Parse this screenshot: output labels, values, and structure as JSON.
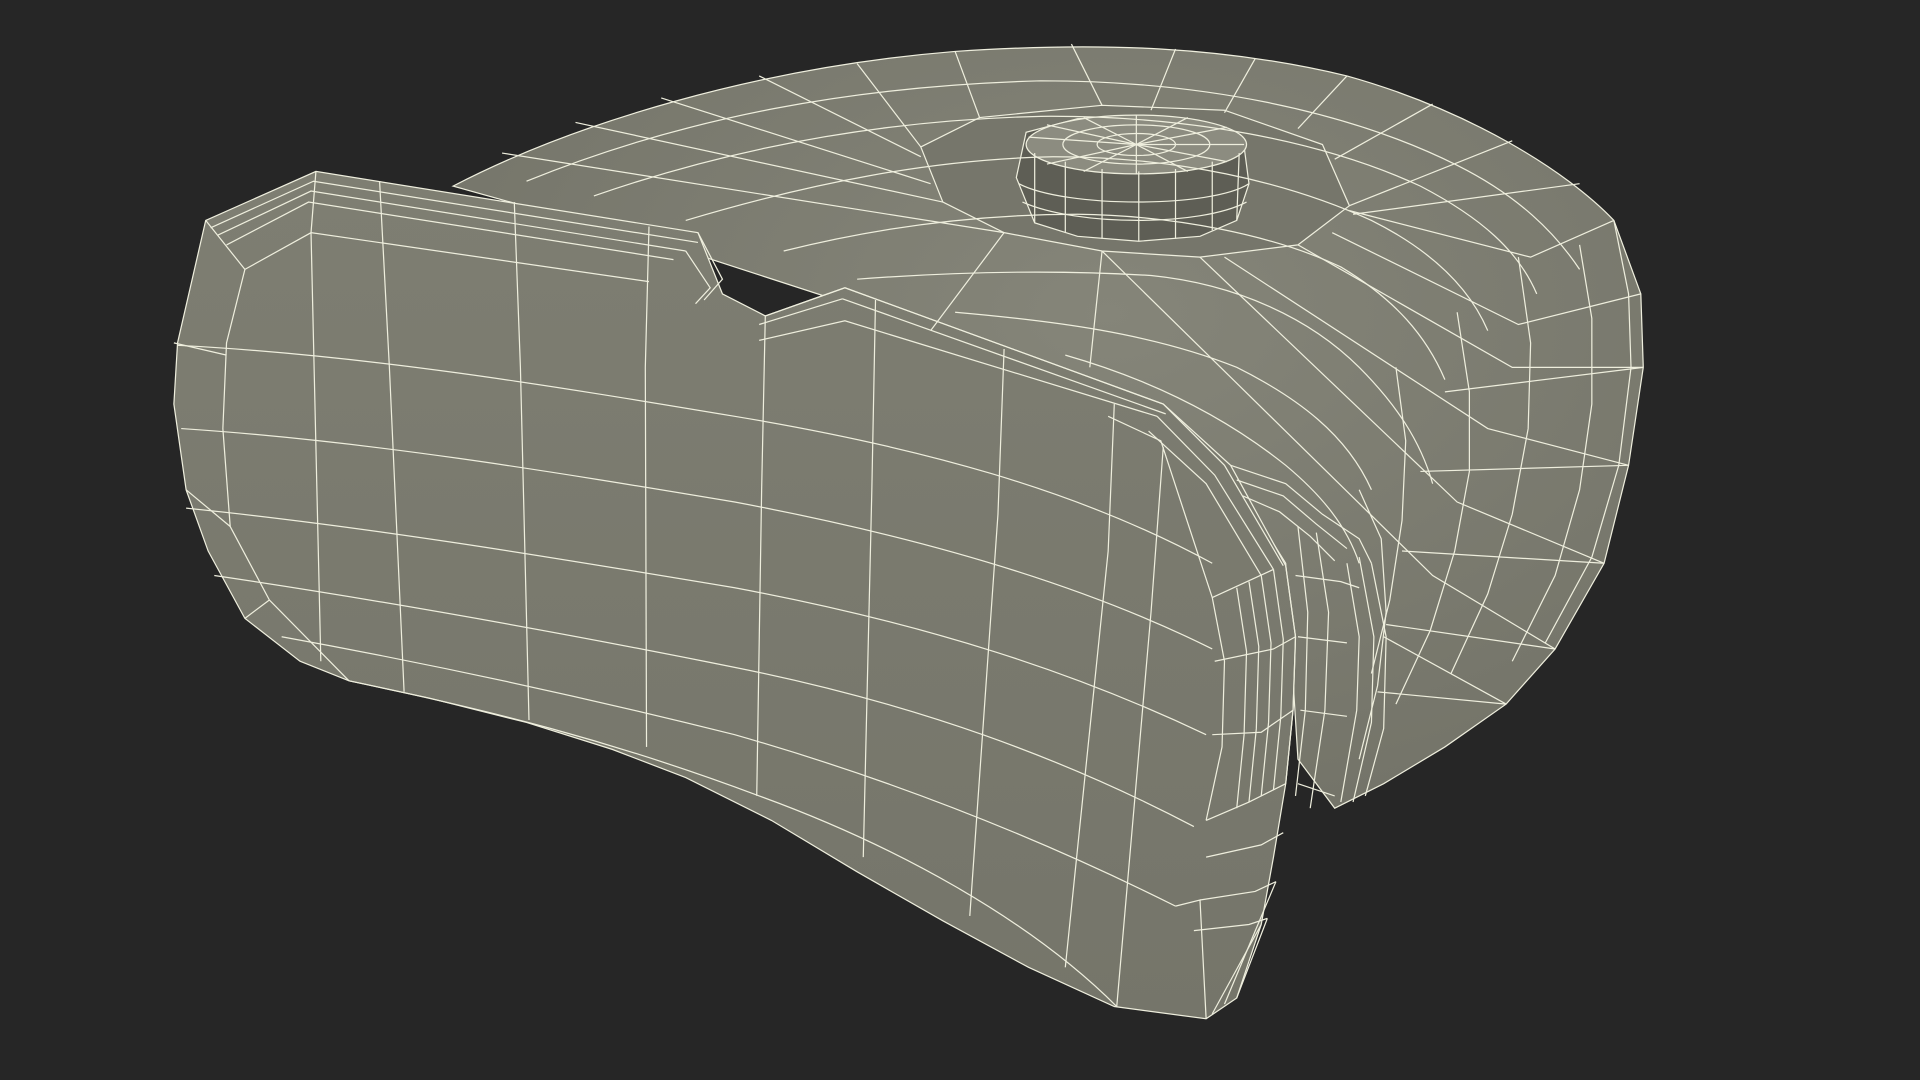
{
  "scene": {
    "subject": "wireframe-3d-model",
    "colors": {
      "background": "#262626",
      "surface": "#7c7c70",
      "surface_shadow": "#5f5f55",
      "surface_light": "#8a8a7e",
      "wire": "#eeeedd"
    }
  }
}
